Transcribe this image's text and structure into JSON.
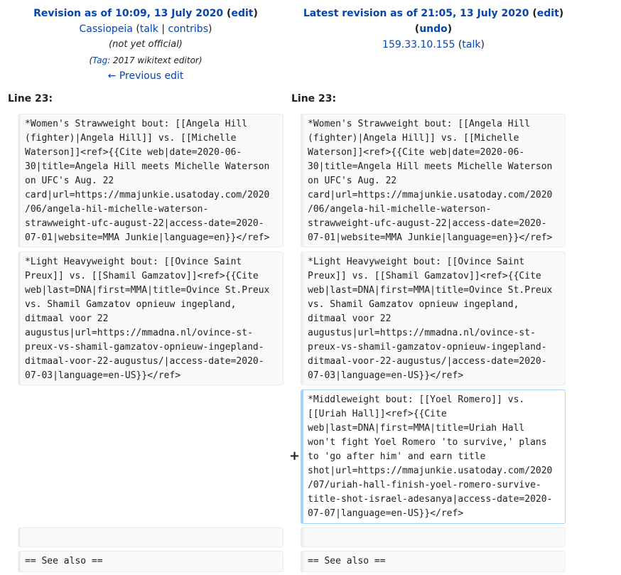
{
  "left_header": {
    "title_prefix": "Revision as of 10:09, 13 July 2020",
    "edit_label": "edit",
    "user": "Cassiopeia",
    "talk": "talk",
    "contribs": "contribs",
    "status": "(not yet official)",
    "tag_label": "Tag",
    "tag_value": "2017 wikitext editor",
    "previous_edit": "← Previous edit"
  },
  "right_header": {
    "title_prefix": "Latest revision as of 21:05, 13 July 2020",
    "edit_label": "edit",
    "undo_label": "undo",
    "ip": "159.33.10.155",
    "talk": "talk"
  },
  "line_label": "Line 23:",
  "diff_marker": "+",
  "rows": [
    {
      "left": "*Women's Strawweight bout: [[Angela Hill\n(fighter)|Angela Hill]] vs. [[Michelle\nWaterson]]<ref>{{Cite web|date=2020-06-\n30|title=Angela Hill meets Michelle Waterson\non UFC's Aug. 22\ncard|url=https://mmajunkie.usatoday.com/2020\n/06/angela-hil-michelle-waterson-\nstrawweight-ufc-august-22|access-date=2020-\n07-01|website=MMA Junkie|language=en}}</ref>",
      "right": "*Women's Strawweight bout: [[Angela Hill\n(fighter)|Angela Hill]] vs. [[Michelle\nWaterson]]<ref>{{Cite web|date=2020-06-\n30|title=Angela Hill meets Michelle Waterson\non UFC's Aug. 22\ncard|url=https://mmajunkie.usatoday.com/2020\n/06/angela-hil-michelle-waterson-\nstrawweight-ufc-august-22|access-date=2020-\n07-01|website=MMA Junkie|language=en}}</ref>"
    },
    {
      "left": "*Light Heavyweight bout: [[Ovince Saint\nPreux]] vs. [[Shamil Gamzatov]]<ref>{{Cite\nweb|last=DNA|first=MMA|title=Ovince St.Preux\nvs. Shamil Gamzatov opnieuw ingepland,\nditmaal voor 22\naugustus|url=https://mmadna.nl/ovince-st-\npreux-vs-shamil-gamzatov-opnieuw-ingepland-\nditmaal-voor-22-augustus/|access-date=2020-\n07-03|language=en-US}}</ref>",
      "right": "*Light Heavyweight bout: [[Ovince Saint\nPreux]] vs. [[Shamil Gamzatov]]<ref>{{Cite\nweb|last=DNA|first=MMA|title=Ovince St.Preux\nvs. Shamil Gamzatov opnieuw ingepland,\nditmaal voor 22\naugustus|url=https://mmadna.nl/ovince-st-\npreux-vs-shamil-gamzatov-opnieuw-ingepland-\nditmaal-voor-22-augustus/|access-date=2020-\n07-03|language=en-US}}</ref>"
    },
    {
      "added": "*Middleweight bout: [[Yoel Romero]] vs.\n[[Uriah Hall]]<ref>{{Cite\nweb|last=DNA|first=MMA|title=Uriah Hall\nwon't fight Yoel Romero 'to survive,' plans\nto 'go after him' and earn title\nshot|url=https://mmajunkie.usatoday.com/2020\n/07/uriah-hall-finish-yoel-romero-survive-\ntitle-shot-israel-adesanya|access-date=2020-\n07-07|language=en-US}}</ref>"
    },
    {
      "left": "",
      "right": ""
    },
    {
      "left": "== See also ==",
      "right": "== See also =="
    }
  ]
}
